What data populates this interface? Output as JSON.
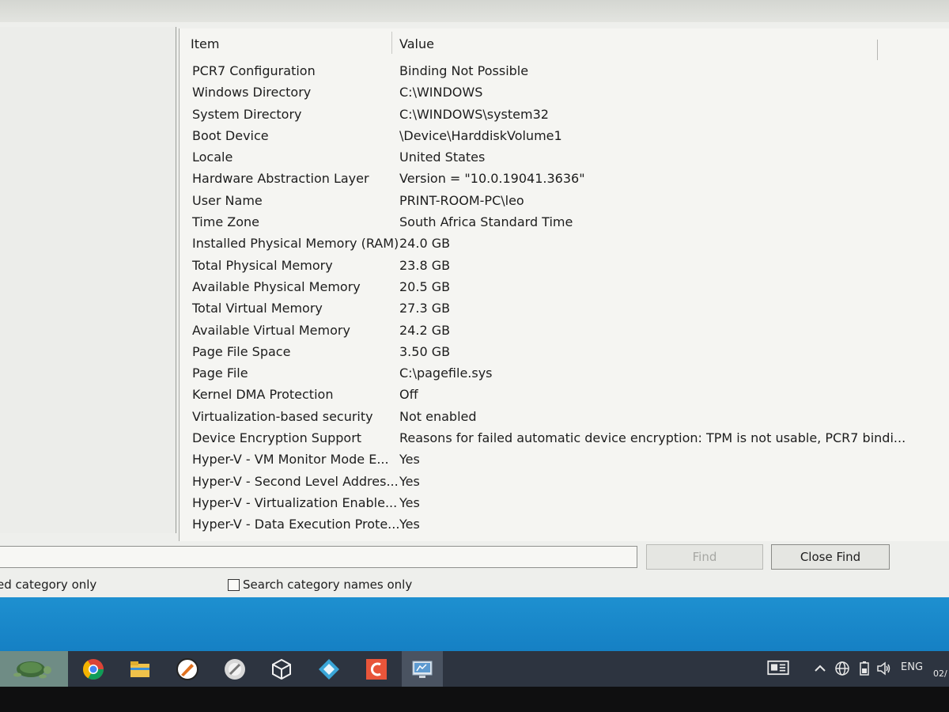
{
  "list": {
    "headers": {
      "item": "Item",
      "value": "Value"
    },
    "rows": [
      {
        "item": "PCR7 Configuration",
        "value": "Binding Not Possible"
      },
      {
        "item": "Windows Directory",
        "value": "C:\\WINDOWS"
      },
      {
        "item": "System Directory",
        "value": "C:\\WINDOWS\\system32"
      },
      {
        "item": "Boot Device",
        "value": "\\Device\\HarddiskVolume1"
      },
      {
        "item": "Locale",
        "value": "United States"
      },
      {
        "item": "Hardware Abstraction Layer",
        "value": "Version = \"10.0.19041.3636\""
      },
      {
        "item": "User Name",
        "value": "PRINT-ROOM-PC\\leo"
      },
      {
        "item": "Time Zone",
        "value": "South Africa Standard Time"
      },
      {
        "item": "Installed Physical Memory (RAM)",
        "value": "24.0 GB"
      },
      {
        "item": "Total Physical Memory",
        "value": "23.8 GB"
      },
      {
        "item": "Available Physical Memory",
        "value": "20.5 GB"
      },
      {
        "item": "Total Virtual Memory",
        "value": "27.3 GB"
      },
      {
        "item": "Available Virtual Memory",
        "value": "24.2 GB"
      },
      {
        "item": "Page File Space",
        "value": "3.50 GB"
      },
      {
        "item": "Page File",
        "value": "C:\\pagefile.sys"
      },
      {
        "item": "Kernel DMA Protection",
        "value": "Off"
      },
      {
        "item": "Virtualization-based security",
        "value": "Not enabled"
      },
      {
        "item": "Device Encryption Support",
        "value": "Reasons for failed automatic device encryption: TPM is not usable, PCR7 bindi..."
      },
      {
        "item": "Hyper-V - VM Monitor Mode E...",
        "value": "Yes"
      },
      {
        "item": "Hyper-V - Second Level Addres...",
        "value": "Yes"
      },
      {
        "item": "Hyper-V - Virtualization Enable...",
        "value": "Yes"
      },
      {
        "item": "Hyper-V - Data Execution Prote...",
        "value": "Yes"
      }
    ]
  },
  "find_bar": {
    "search_value": "",
    "find_label": "Find",
    "close_find_label": "Close Find",
    "selected_category_label": "ed category only",
    "search_category_names_label": "Search category names only",
    "search_category_names_checked": false
  },
  "taskbar": {
    "apps": [
      "turtle-logo-icon",
      "chrome-icon",
      "file-explorer-icon",
      "app-icon",
      "app-icon",
      "3d-box-icon",
      "diamond-app-icon",
      "red-app-icon",
      "system-information-icon"
    ],
    "tray": {
      "language": "ENG",
      "clock_fragment": "02/"
    }
  },
  "colors": {
    "desktop_blue": "#1580c4",
    "taskbar": "#2d3440",
    "window_bg": "#eeefec"
  }
}
